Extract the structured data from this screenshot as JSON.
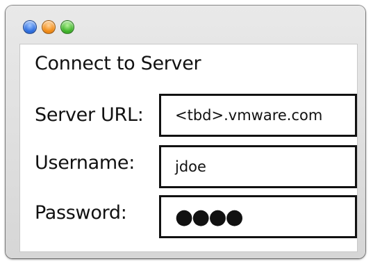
{
  "window": {
    "traffic_lights": [
      "close-button",
      "minimize-button",
      "zoom-button"
    ],
    "colors": {
      "close": "#2f6fe0",
      "minimize": "#f28c16",
      "zoom": "#3fb52a"
    }
  },
  "dialog": {
    "title": "Connect to Server",
    "fields": [
      {
        "label": "Server URL:",
        "value": "<tbd>.vmware.com"
      },
      {
        "label": "Username:",
        "value": "jdoe"
      },
      {
        "label": "Password:",
        "value": "●●●●"
      }
    ]
  }
}
